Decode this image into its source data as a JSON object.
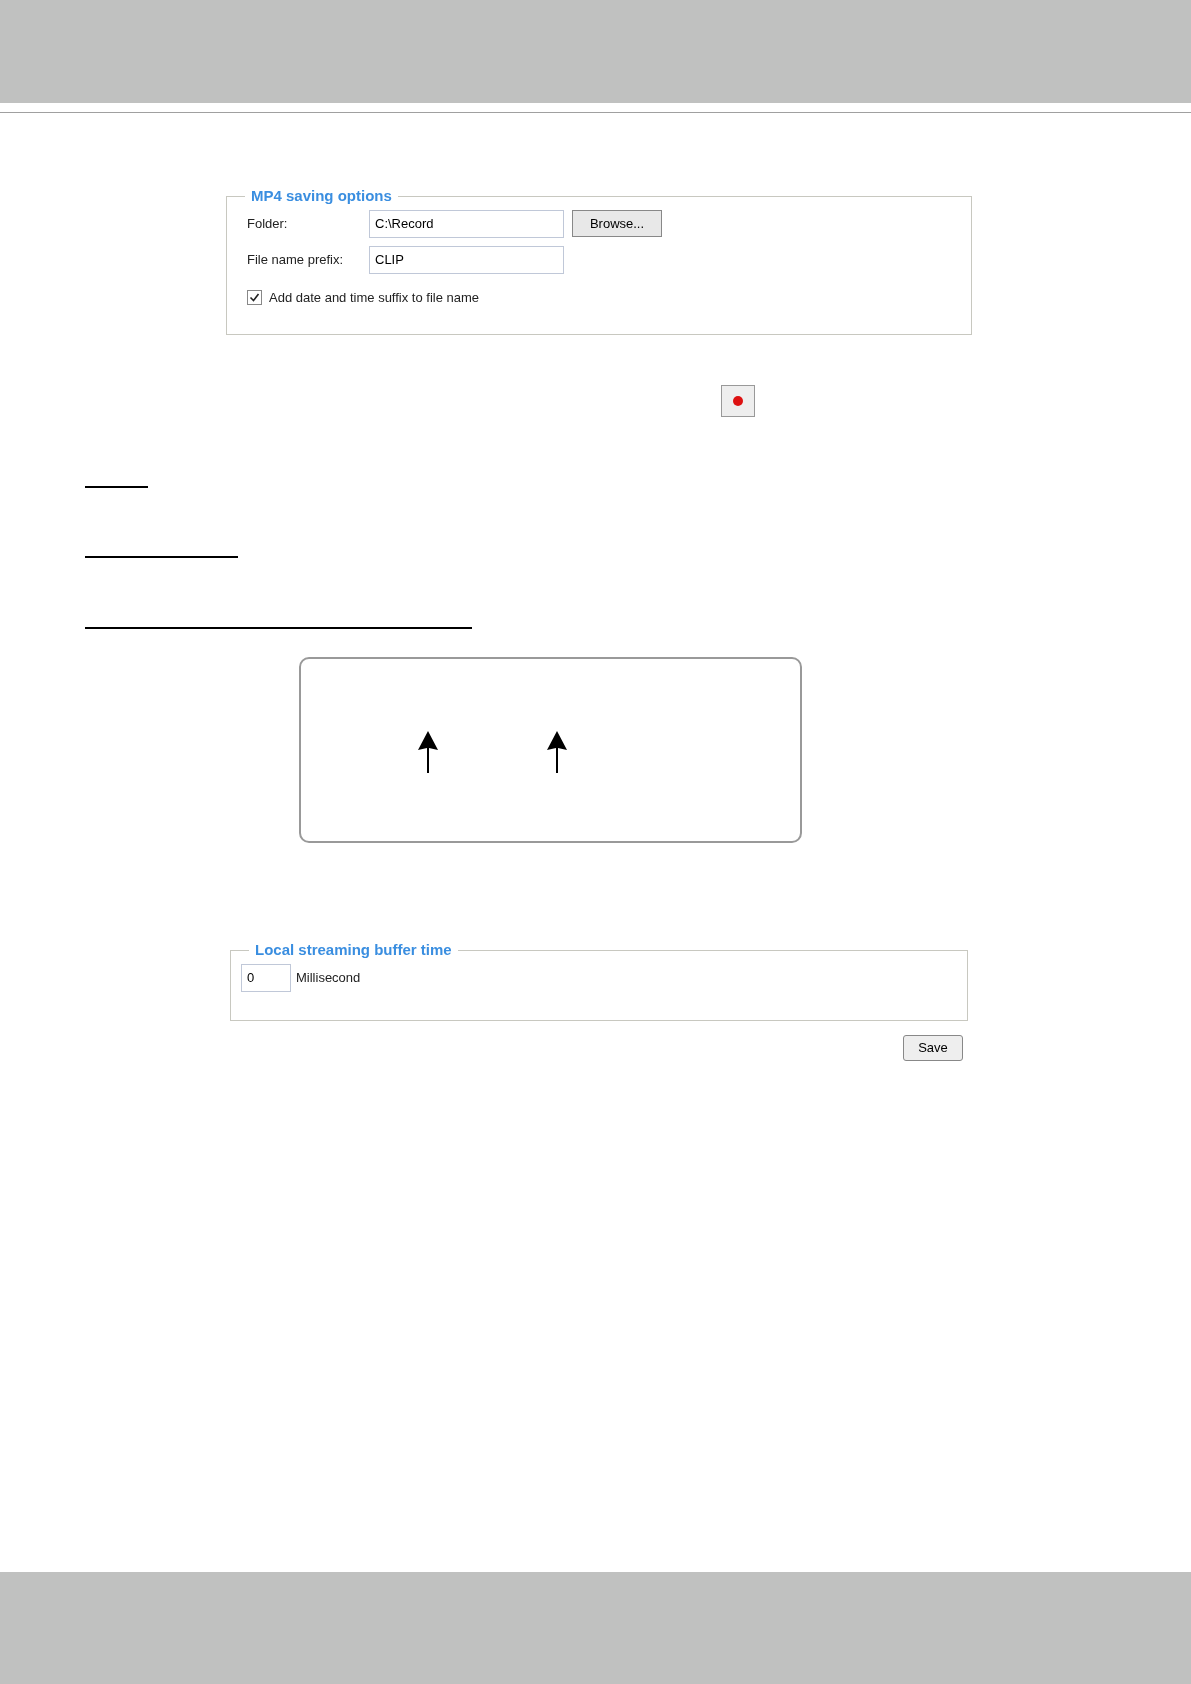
{
  "mp4_saving_options": {
    "legend": "MP4 saving options",
    "folder": {
      "label": "Folder:",
      "value": "C:\\Record",
      "button": "Browse..."
    },
    "prefix": {
      "label": "File name prefix:",
      "value": "CLIP"
    },
    "suffix": {
      "label": "Add date and time suffix to file name",
      "checked": true
    }
  },
  "buffer": {
    "legend": "Local streaming buffer time",
    "value": "0",
    "unit": "Millisecond",
    "button": "Save"
  }
}
